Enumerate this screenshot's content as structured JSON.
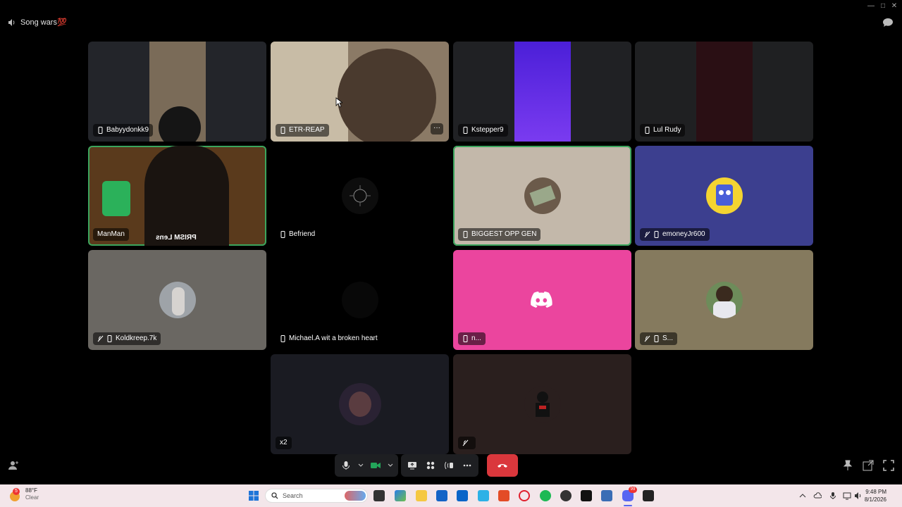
{
  "window": {
    "channel_name": "Song wars💯"
  },
  "tiles": [
    {
      "name": "Babyydonkk9"
    },
    {
      "name": "ETR-REAP",
      "more": "···"
    },
    {
      "name": "Kstepper9"
    },
    {
      "name": "Lul Rudy"
    },
    {
      "name": "ManMan",
      "overlay_text": "PRISM Lens"
    },
    {
      "name": "Befriend"
    },
    {
      "name": "BIGGEST OPP GEN"
    },
    {
      "name": "emoneyJr600"
    },
    {
      "name": "Koldkreep.7k"
    },
    {
      "name": "Michael.A wit a broken heart"
    },
    {
      "name": "n..."
    },
    {
      "name": "S..."
    },
    {
      "name": "x2"
    },
    {
      "name": ""
    }
  ],
  "colors": {
    "speaking_border": "#3ba55d",
    "discord_pink": "#eb459e",
    "emoney_bg": "#3c3f8f",
    "hangup": "#da373c"
  },
  "taskbar": {
    "weather_temp": "88°F",
    "weather_desc": "Clear",
    "weather_badge": "5",
    "search_placeholder": "Search",
    "time": "9:48 PM",
    "date": "8/1/2026",
    "discord_badge": "99"
  }
}
